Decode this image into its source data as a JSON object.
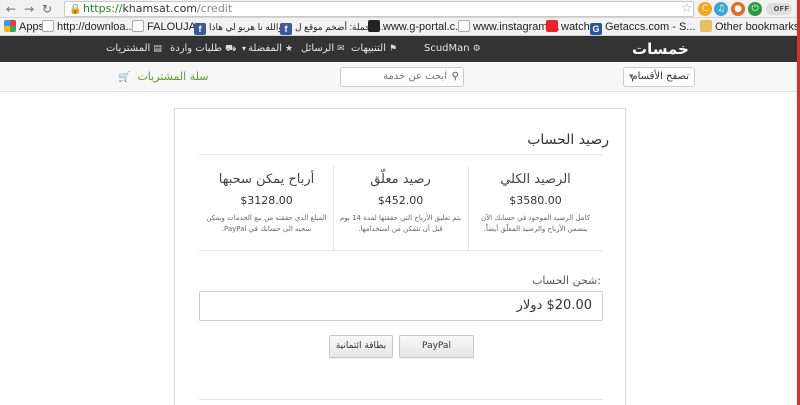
{
  "browser": {
    "url_protocol": "https://",
    "url_host": "khamsat.com",
    "url_path": "/credit",
    "off_label": "OFF"
  },
  "bookmarks": [
    {
      "label": "Apps",
      "icon": "apps-grid-icon"
    },
    {
      "label": "http://downloa...",
      "icon": "page-icon"
    },
    {
      "label": "FALOUJA",
      "icon": "page-icon"
    },
    {
      "label": "والله نا هربو لي هاذا ...",
      "icon": "facebook-icon"
    },
    {
      "label": "الحملة: أضخم موقع ل...",
      "icon": "facebook-icon"
    },
    {
      "label": "www.g-portal.c...",
      "icon": "gportal-icon"
    },
    {
      "label": "www.instagram....",
      "icon": "page-icon"
    },
    {
      "label": "watch",
      "icon": "folder-icon"
    },
    {
      "label": "Getaccs.com - S...",
      "icon": "getaccs-icon"
    },
    {
      "label": "Other bookmarks",
      "icon": "folder-icon"
    }
  ],
  "header": {
    "logo_main": "خمسات",
    "nav": {
      "user": "ScudMan",
      "notifications": "التنبيهات",
      "messages": "الرسائل",
      "favorites": "المفضلة",
      "incoming_requests": "طلبات واردة",
      "purchases": "المشتريات"
    }
  },
  "subheader": {
    "category_select": "تصفح الأقسام",
    "search_placeholder": "ابحث عن خدمة",
    "cart_label": "سلة المشتريات"
  },
  "credit": {
    "title": "رصيد الحساب",
    "columns": [
      {
        "title": "الرصيد الكلي",
        "amount": "$3580.00",
        "description": "كامل الرصيد الموجود في حسابك الآن يتضمن الأرباح والرصيد المعلّق أيضاً."
      },
      {
        "title": "رصيد معلّق",
        "amount": "$452.00",
        "description": "يتم تعليق الأرباح التي حققتها لمدة 14 يوم قبل أن تتمكن من استخدامها."
      },
      {
        "title": "أرباح يمكن سحبها",
        "amount": "$3128.00",
        "description": "المبلغ الذي حققته من بيع الخدمات ويمكن سحبه الى حسابك في PayPal."
      }
    ],
    "charge_label": "شحن الحساب:",
    "charge_amount": "$20.00 دولار",
    "buttons": {
      "paypal": "PayPal",
      "credit_card": "بطاقة ائتمانية"
    }
  },
  "colors": {
    "header_bg": "#333333",
    "logo_accent": "#f4a71d",
    "cart_green": "#5aa12c",
    "url_green": "#1a8a1a"
  }
}
